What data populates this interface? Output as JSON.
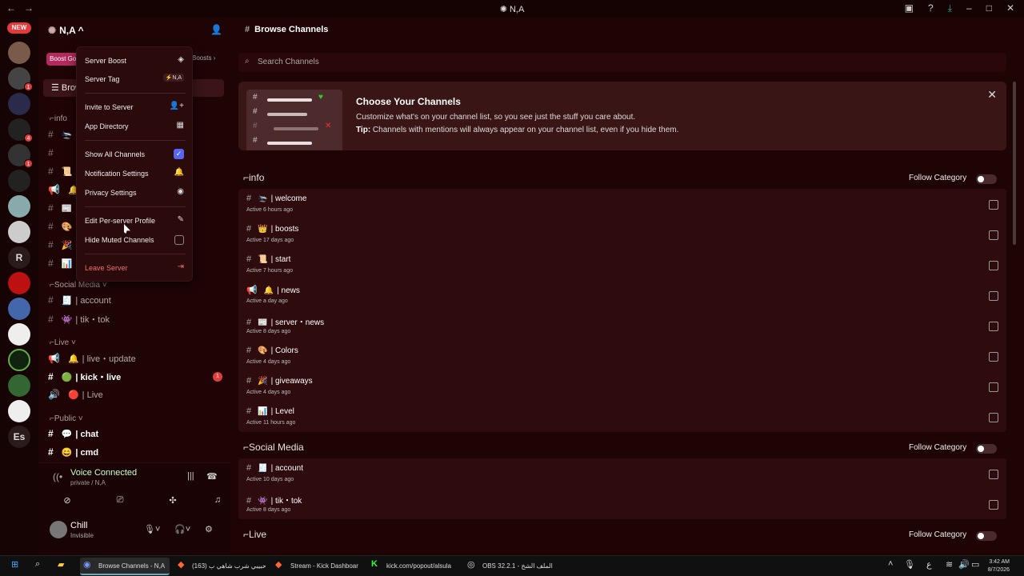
{
  "window": {
    "title": "N,A",
    "nav_back": "←",
    "nav_fwd": "→"
  },
  "servers": {
    "new_badge": "NEW",
    "pips": [
      "1",
      "4",
      "1",
      "1"
    ],
    "letters": [
      "R",
      "Es"
    ]
  },
  "sidebar": {
    "server_name": "N,A",
    "chevron": "^",
    "boost_label": "Boost Go",
    "boost_link": "Boosts",
    "browse_label": "Brow",
    "categories": {
      "info": "info",
      "social": "Social Media",
      "live": "Live",
      "public": "Public"
    },
    "social_channels": [
      {
        "emoji": "🧾",
        "name": "account"
      },
      {
        "emoji": "👾",
        "name": "tik・tok"
      }
    ],
    "live_channels": [
      {
        "emoji": "🔔",
        "name": "live・update",
        "icon": "speaker"
      },
      {
        "emoji": "🟢",
        "name": "kick・live",
        "badge": "1"
      },
      {
        "emoji": "🔴",
        "name": "Live",
        "icon": "voice"
      }
    ],
    "public_channels": [
      {
        "emoji": "💬",
        "name": "chat"
      },
      {
        "emoji": "😄",
        "name": "cmd"
      }
    ],
    "info_emojis": [
      "🛬",
      "📜",
      "🔔",
      "📰",
      "🎨",
      "🎉",
      "📊"
    ]
  },
  "menu": {
    "items": [
      {
        "label": "Server Boost",
        "icon": "◈"
      },
      {
        "label": "Server Tag",
        "icon": "⚡N,A"
      },
      {
        "label": "Invite to Server",
        "icon": "👤+"
      },
      {
        "label": "App Directory",
        "icon": "▦"
      },
      {
        "label": "Show All Channels",
        "icon": "✓"
      },
      {
        "label": "Notification Settings",
        "icon": "🔔"
      },
      {
        "label": "Privacy Settings",
        "icon": "◉"
      },
      {
        "label": "Edit Per-server Profile",
        "icon": "✎"
      },
      {
        "label": "Hide Muted Channels",
        "icon": ""
      },
      {
        "label": "Leave Server",
        "icon": "⇥"
      }
    ]
  },
  "voice": {
    "status": "Voice Connected",
    "sub": "private / N,A"
  },
  "user": {
    "name": "Chill",
    "status": "Invisible"
  },
  "main": {
    "header": "Browse Channels",
    "search_placeholder": "Search Channels",
    "banner": {
      "title": "Choose Your Channels",
      "desc": "Customize what's on your channel list, so you see just the stuff you care about.",
      "tip_label": "Tip:",
      "tip": " Channels with mentions will always appear on your channel list, even if you hide them."
    },
    "follow_label": "Follow Category",
    "categories": [
      {
        "name": "info",
        "channels": [
          {
            "emoji": "🛬",
            "name": "welcome",
            "active": "Active 6 hours ago"
          },
          {
            "emoji": "👑",
            "name": "boosts",
            "active": "Active 17 days ago"
          },
          {
            "emoji": "📜",
            "name": "start",
            "active": "Active 7 hours ago"
          },
          {
            "emoji": "🔔",
            "name": "news",
            "active": "Active a day ago",
            "speaker": true
          },
          {
            "emoji": "📰",
            "name": "server・news",
            "active": "Active 8 days ago"
          },
          {
            "emoji": "🎨",
            "name": "Colors",
            "active": "Active 4 days ago"
          },
          {
            "emoji": "🎉",
            "name": "giveaways",
            "active": "Active 4 days ago"
          },
          {
            "emoji": "📊",
            "name": "Level",
            "active": "Active 11 hours ago"
          }
        ]
      },
      {
        "name": "Social Media",
        "channels": [
          {
            "emoji": "🧾",
            "name": "account",
            "active": "Active 10 days ago"
          },
          {
            "emoji": "👾",
            "name": "tik・tok",
            "active": "Active 8 days ago"
          }
        ]
      },
      {
        "name": "Live",
        "channels": []
      }
    ]
  },
  "taskbar": {
    "items": [
      {
        "label": "Browse Channels - N,A"
      },
      {
        "label": "(163) حبيبي شرب شاهي ب"
      },
      {
        "label": "Stream - Kick Dashboar"
      },
      {
        "label": "kick.com/popout/alsula"
      },
      {
        "label": "OBS 32.2.1 - الملف الشخ"
      }
    ],
    "lang": "ع",
    "time": "3:42 AM",
    "date": "8/7/2026"
  }
}
